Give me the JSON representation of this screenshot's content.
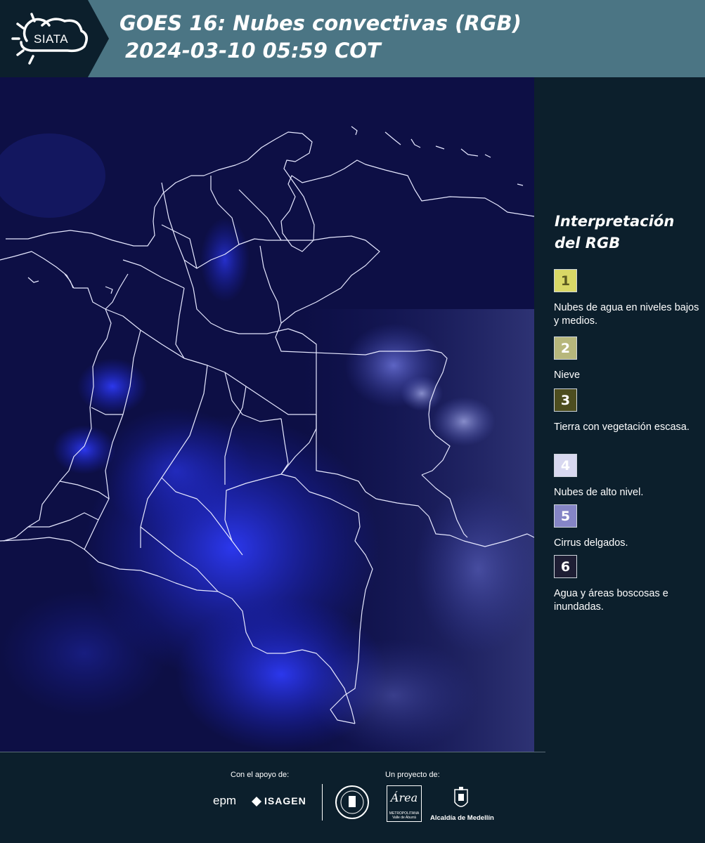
{
  "header": {
    "brand": "SIATA",
    "title_line1": "GOES 16: Nubes convectivas (RGB)",
    "title_line2": "2024-03-10 05:59 COT",
    "background_color": "#4b7584"
  },
  "map": {
    "description_icon": "satellite-rgb-image",
    "background_color": "#0d0f45",
    "highlight_color": "#2a35ff"
  },
  "legend": {
    "title": "Interpretación del RGB",
    "items": [
      {
        "number": "1",
        "label": "Nubes de agua en niveles bajos y medios.",
        "color": "#d9d866"
      },
      {
        "number": "2",
        "label": "Nieve",
        "color": "#b7b77c"
      },
      {
        "number": "3",
        "label": "Tierra con vegetación escasa.",
        "color": "#4d4d1f"
      },
      {
        "number": "4",
        "label": "Nubes de alto nivel.",
        "color": "#d8d8f0"
      },
      {
        "number": "5",
        "label": "Cirrus delgados.",
        "color": "#8585c6"
      },
      {
        "number": "6",
        "label": "Agua y áreas boscosas e inundadas.",
        "color": "#1e1e34"
      }
    ]
  },
  "footer": {
    "support_label": "Con el apoyo de:",
    "project_label": "Un proyecto de:",
    "sponsors": [
      "epm",
      "ISAGEN"
    ],
    "area_logo_text": "Área",
    "area_logo_sub": "METROPOLITANA Valle de Aburrá",
    "alcaldia": "Alcaldía de Medellín"
  }
}
